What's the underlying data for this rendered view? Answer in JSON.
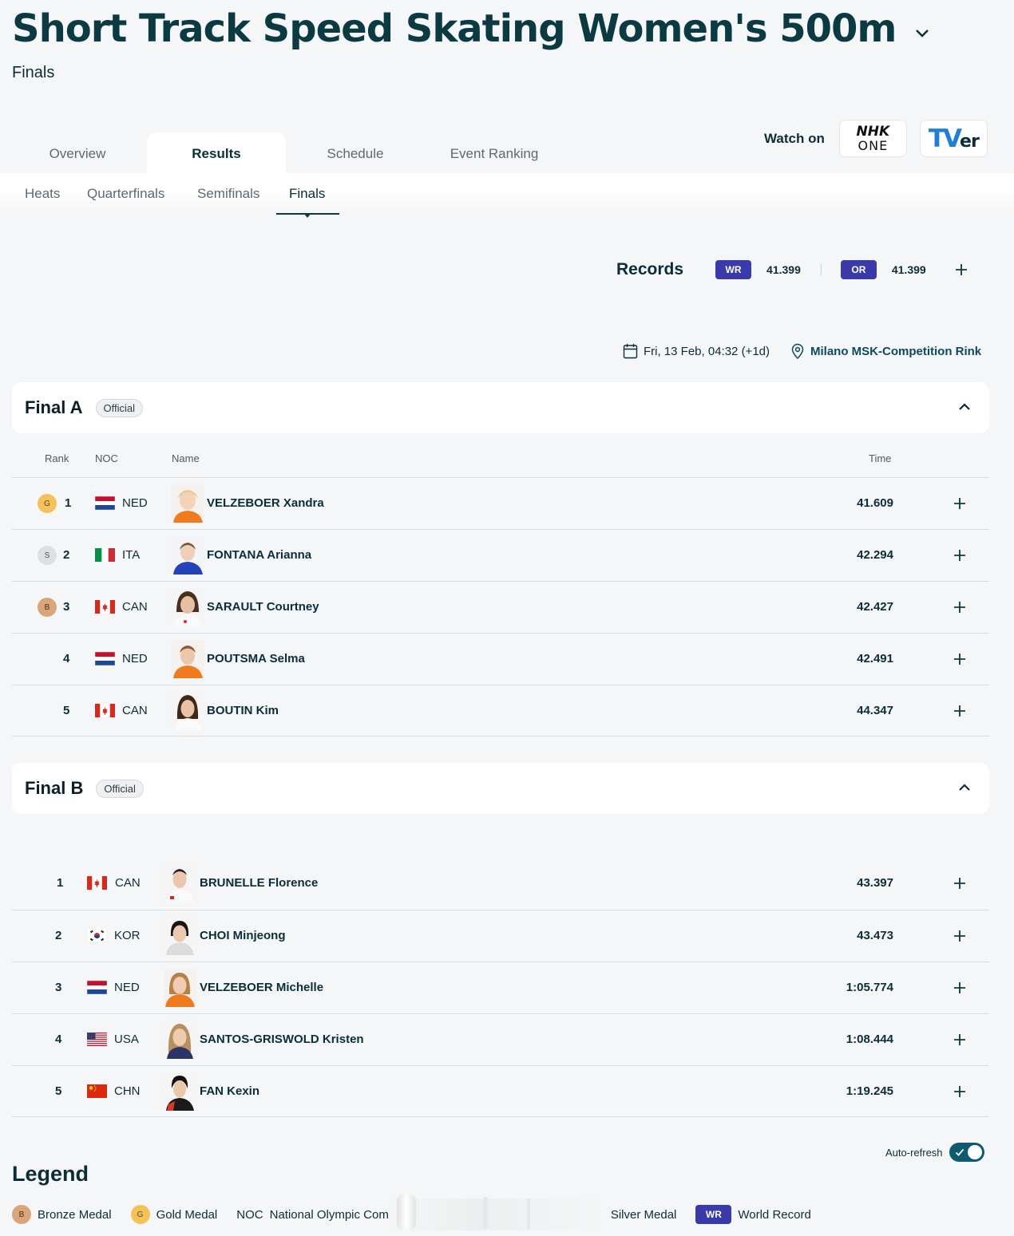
{
  "header": {
    "title": "Short Track Speed Skating Women's 500m",
    "subtitle": "Finals"
  },
  "tabs": [
    {
      "label": "Overview",
      "active": false
    },
    {
      "label": "Results",
      "active": true
    },
    {
      "label": "Schedule",
      "active": false
    },
    {
      "label": "Event Ranking",
      "active": false
    }
  ],
  "watch": {
    "label": "Watch on",
    "broadcasters": [
      {
        "line1": "NHK",
        "line2": "ONE"
      },
      {
        "main": "TV",
        "small": "er"
      }
    ]
  },
  "subtabs": [
    {
      "label": "Heats",
      "active": false
    },
    {
      "label": "Quarterfinals",
      "active": false
    },
    {
      "label": "Semifinals",
      "active": false
    },
    {
      "label": "Finals",
      "active": true
    }
  ],
  "records": {
    "label": "Records",
    "items": [
      {
        "badge": "WR",
        "value": "41.399"
      },
      {
        "badge": "OR",
        "value": "41.399"
      }
    ]
  },
  "session": {
    "date": "Fri, 13 Feb, 04:32 (+1d)",
    "venue": "Milano MSK-Competition Rink"
  },
  "columns": {
    "rank": "Rank",
    "noc": "NOC",
    "name": "Name",
    "time": "Time"
  },
  "final_a": {
    "title": "Final A",
    "status": "Official",
    "rows": [
      {
        "medal": "G",
        "rank": "1",
        "noc": "NED",
        "name": "VELZEBOER Xandra",
        "time": "41.609"
      },
      {
        "medal": "S",
        "rank": "2",
        "noc": "ITA",
        "name": "FONTANA Arianna",
        "time": "42.294"
      },
      {
        "medal": "B",
        "rank": "3",
        "noc": "CAN",
        "name": "SARAULT Courtney",
        "time": "42.427"
      },
      {
        "medal": "",
        "rank": "4",
        "noc": "NED",
        "name": "POUTSMA Selma",
        "time": "42.491"
      },
      {
        "medal": "",
        "rank": "5",
        "noc": "CAN",
        "name": "BOUTIN Kim",
        "time": "44.347"
      }
    ]
  },
  "final_b": {
    "title": "Final B",
    "status": "Official",
    "rows": [
      {
        "rank": "1",
        "noc": "CAN",
        "name": "BRUNELLE Florence",
        "time": "43.397"
      },
      {
        "rank": "2",
        "noc": "KOR",
        "name": "CHOI Minjeong",
        "time": "43.473"
      },
      {
        "rank": "3",
        "noc": "NED",
        "name": "VELZEBOER Michelle",
        "time": "1:05.774"
      },
      {
        "rank": "4",
        "noc": "USA",
        "name": "SANTOS-GRISWOLD Kristen",
        "time": "1:08.444"
      },
      {
        "rank": "5",
        "noc": "CHN",
        "name": "FAN Kexin",
        "time": "1:19.245"
      }
    ]
  },
  "auto_refresh": {
    "label": "Auto-refresh",
    "enabled": true
  },
  "legend": {
    "title": "Legend",
    "items": [
      {
        "symbol": "B",
        "label": "Bronze Medal"
      },
      {
        "symbol": "G",
        "label": "Gold Medal"
      },
      {
        "symbol": "NOC",
        "label": "National Olympic Com"
      },
      {
        "symbol": "",
        "label": "Silver Medal"
      },
      {
        "symbol": "WR",
        "label": "World Record"
      }
    ]
  },
  "colors": {
    "primary_text": "#0b2d3a",
    "record_badge": "#3a3aa8",
    "gold": "#f5c25a",
    "silver": "#dde0e2",
    "bronze": "#d9a67a",
    "toggle": "#0e5a6e"
  }
}
